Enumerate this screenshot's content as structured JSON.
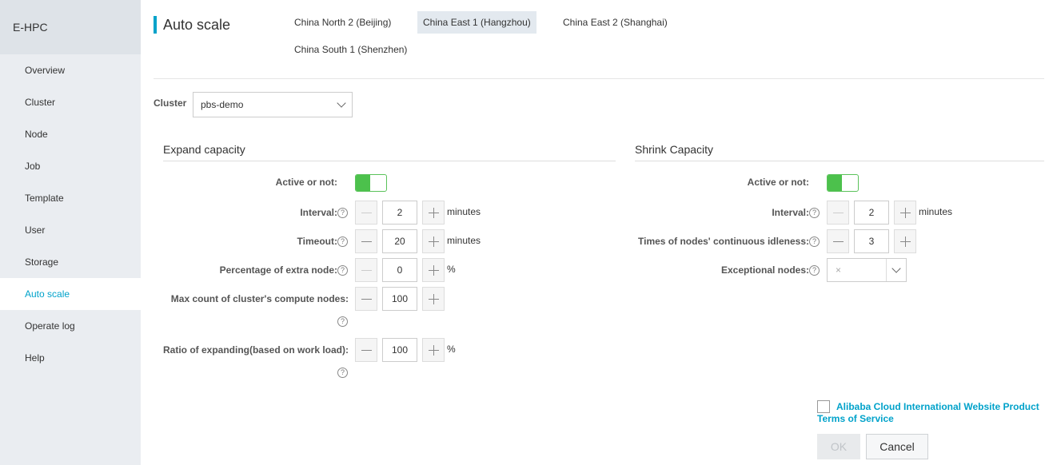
{
  "sidebar": {
    "brand": "E-HPC",
    "items": [
      {
        "label": "Overview"
      },
      {
        "label": "Cluster"
      },
      {
        "label": "Node"
      },
      {
        "label": "Job"
      },
      {
        "label": "Template"
      },
      {
        "label": "User"
      },
      {
        "label": "Storage"
      },
      {
        "label": "Auto scale",
        "active": true
      },
      {
        "label": "Operate log"
      },
      {
        "label": "Help"
      }
    ]
  },
  "header": {
    "title": "Auto scale",
    "regions": [
      {
        "label": "China North 2 (Beijing)"
      },
      {
        "label": "China East 1 (Hangzhou)",
        "active": true
      },
      {
        "label": "China East 2 (Shanghai)"
      },
      {
        "label": "China South 1 (Shenzhen)"
      }
    ]
  },
  "cluster": {
    "label": "Cluster",
    "value": "pbs-demo"
  },
  "expand": {
    "title": "Expand capacity",
    "active_label": "Active or not:",
    "active": true,
    "interval_label": "Interval:",
    "interval_value": "2",
    "interval_unit": "minutes",
    "timeout_label": "Timeout:",
    "timeout_value": "20",
    "timeout_unit": "minutes",
    "extra_label": "Percentage of extra node:",
    "extra_value": "0",
    "extra_unit": "%",
    "max_label": "Max count of cluster's compute nodes:",
    "max_value": "100",
    "ratio_label": "Ratio of expanding(based on work load):",
    "ratio_value": "100",
    "ratio_unit": "%"
  },
  "shrink": {
    "title": "Shrink Capacity",
    "active_label": "Active or not:",
    "active": true,
    "interval_label": "Interval:",
    "interval_value": "2",
    "interval_unit": "minutes",
    "idle_label": "Times of nodes' continuous idleness:",
    "idle_value": "3",
    "exceptional_label": "Exceptional nodes:",
    "exceptional_clear": "×"
  },
  "help_glyph": "?",
  "footer": {
    "tos": "Alibaba Cloud International Website Product Terms of Service",
    "ok": "OK",
    "cancel": "Cancel"
  },
  "colors": {
    "accent": "#00a2ca",
    "toggle_on": "#4cc14c",
    "sidebar_bg": "#eaedf1"
  }
}
